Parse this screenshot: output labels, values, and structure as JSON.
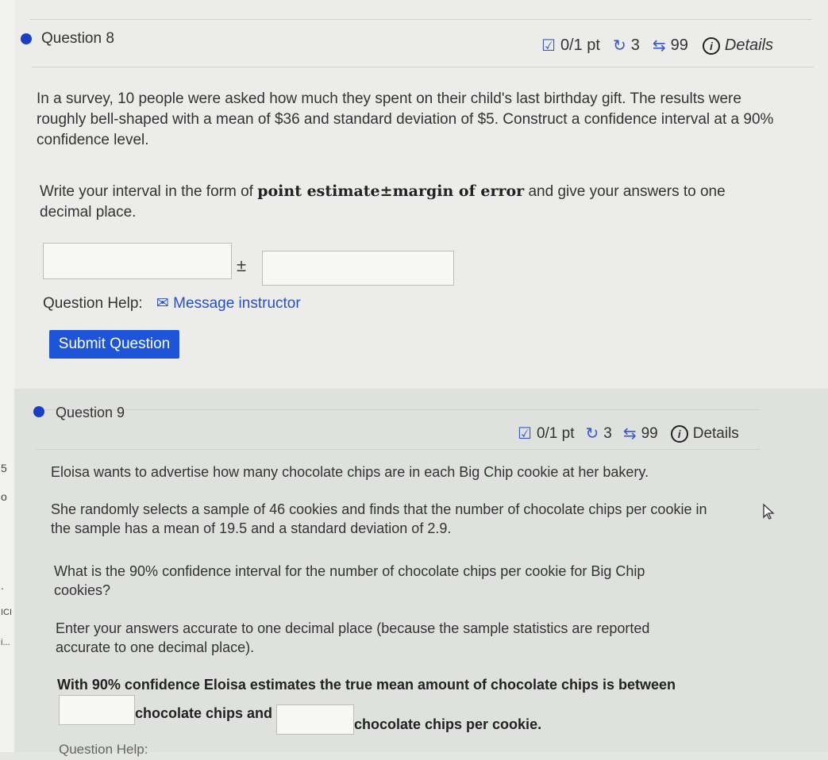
{
  "left_strip": [
    "5",
    "o",
    ".",
    "ICI",
    "i..."
  ],
  "question8": {
    "title": "Question 8",
    "score": "0/1 pt",
    "retries": "3",
    "attempts": "99",
    "details": "Details",
    "text": "In a survey, 10 people were asked how much they spent on their child's last birthday gift. The results were roughly bell-shaped with a mean of $36 and standard deviation of $5. Construct a confidence interval at a 90% confidence level.",
    "instruction_before": "Write your interval in the form of",
    "instruction_formula": "point estimate±margin of error",
    "instruction_after": "and give your answers to one decimal place.",
    "point_estimate_value": "",
    "margin_value": "",
    "plus_minus": "±",
    "help_label": "Question Help:",
    "message_link": "Message instructor",
    "submit_label": "Submit Question"
  },
  "question9": {
    "title": "Question 9",
    "score": "0/1 pt",
    "retries": "3",
    "attempts": "99",
    "details": "Details",
    "p1": "Eloisa wants to advertise how many chocolate chips are in each Big Chip cookie at her bakery.",
    "p2": "She randomly selects a sample of 46 cookies and finds that the number of chocolate chips per cookie in the sample has a mean of 19.5 and a standard deviation of 2.9.",
    "p3": "What is the 90% confidence interval for the number of chocolate chips per cookie for Big Chip cookies?",
    "p4": "Enter your answers accurate to one decimal place (because the sample statistics are reported accurate to one decimal place).",
    "answer_intro": "With 90% confidence Eloisa estimates the true mean amount of chocolate chips is between",
    "answer_mid": "chocolate chips and",
    "answer_end": "chocolate chips per cookie.",
    "lower_value": "",
    "upper_value": "",
    "help_partial": "Question Help:"
  },
  "colors": {
    "accent": "#1e55d8",
    "link": "#2b4dc4",
    "dot": "#1b3fbf"
  }
}
